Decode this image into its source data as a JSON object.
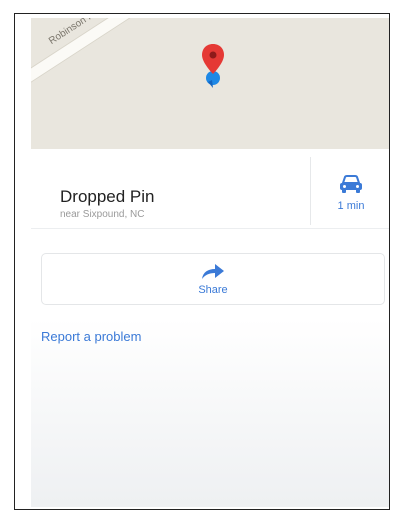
{
  "map": {
    "road_label": "Robinson Ferry"
  },
  "place": {
    "title": "Dropped Pin",
    "subtitle": "near Sixpound, NC"
  },
  "directions": {
    "drive_time": "1 min",
    "icon": "car-icon"
  },
  "actions": {
    "share_label": "Share",
    "share_icon": "share-arrow-icon"
  },
  "links": {
    "report_label": "Report a problem"
  },
  "colors": {
    "accent": "#3b7ad7",
    "pin": "#e53935",
    "location": "#1e88e5"
  }
}
